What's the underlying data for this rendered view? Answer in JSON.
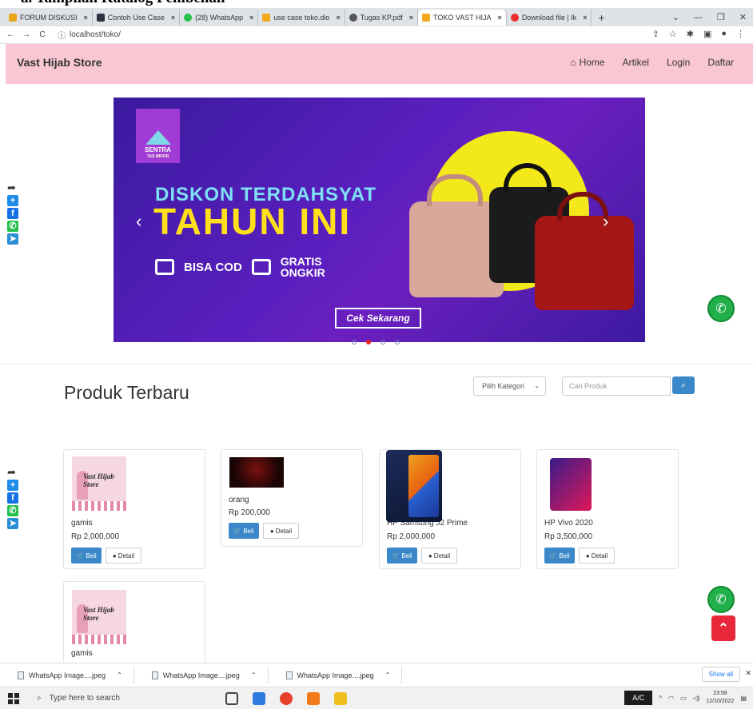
{
  "doc_heading": "a.   Tampilan Katalog Pembelian",
  "browser": {
    "tabs": [
      {
        "label": "FORUM DISKUSI",
        "color": "#e9a51a"
      },
      {
        "label": "Contoh Use Case",
        "color": "#2d3340"
      },
      {
        "label": "(28) WhatsApp",
        "color": "#22c14a"
      },
      {
        "label": "use case toko.dio",
        "color": "#f2a91b"
      },
      {
        "label": "Tugas KP.pdf",
        "color": "#555555"
      },
      {
        "label": "TOKO VAST HIJA",
        "color": "#f2a91b",
        "active": true
      },
      {
        "label": "Download file | Ik",
        "color": "#e82b2b"
      }
    ],
    "new_tab": "+",
    "url": "localhost/toko/"
  },
  "navbar": {
    "brand": "Vast Hijab Store",
    "links": {
      "home": "Home",
      "artikel": "Artikel",
      "login": "Login",
      "daftar": "Daftar"
    }
  },
  "banner": {
    "logo_top": "SENTRA",
    "logo_sub": "TAS IMPOR",
    "headline": "DISKON TERDAHSYAT",
    "headline_big": "TAHUN INI",
    "cod": "BISA COD",
    "ongkir_1": "GRATIS",
    "ongkir_2": "ONGKIR",
    "cta": "Cek Sekarang",
    "prev": "‹",
    "next": "›",
    "slide_count": 4,
    "active_slide": 2
  },
  "catalog": {
    "title": "Produk Terbaru",
    "category_select": "Pilih Kategori",
    "search_placeholder": "Cari Produk",
    "buy_label": "Beli",
    "detail_label": "Detail",
    "products": [
      {
        "name": "gamis",
        "price": "Rp 2,000,000"
      },
      {
        "name": "orang",
        "price": "Rp 200,000"
      },
      {
        "name": "HP Samsung J2 Prime",
        "price": "Rp 2,000,000"
      },
      {
        "name": "HP Vivo 2020",
        "price": "Rp 3,500,000"
      },
      {
        "name": "gamis",
        "price": ""
      }
    ]
  },
  "hijab_logo": {
    "line1": "Vast Hijab",
    "line2": "Store"
  },
  "downloads": {
    "items": [
      "WhatsApp Image....jpeg",
      "WhatsApp Image....jpeg",
      "WhatsApp Image....jpeg"
    ],
    "show_all": "Show all"
  },
  "taskbar": {
    "search_placeholder": "Type here to search",
    "tray_label": "A/C",
    "time": "23:58",
    "date": "12/10/2022"
  }
}
